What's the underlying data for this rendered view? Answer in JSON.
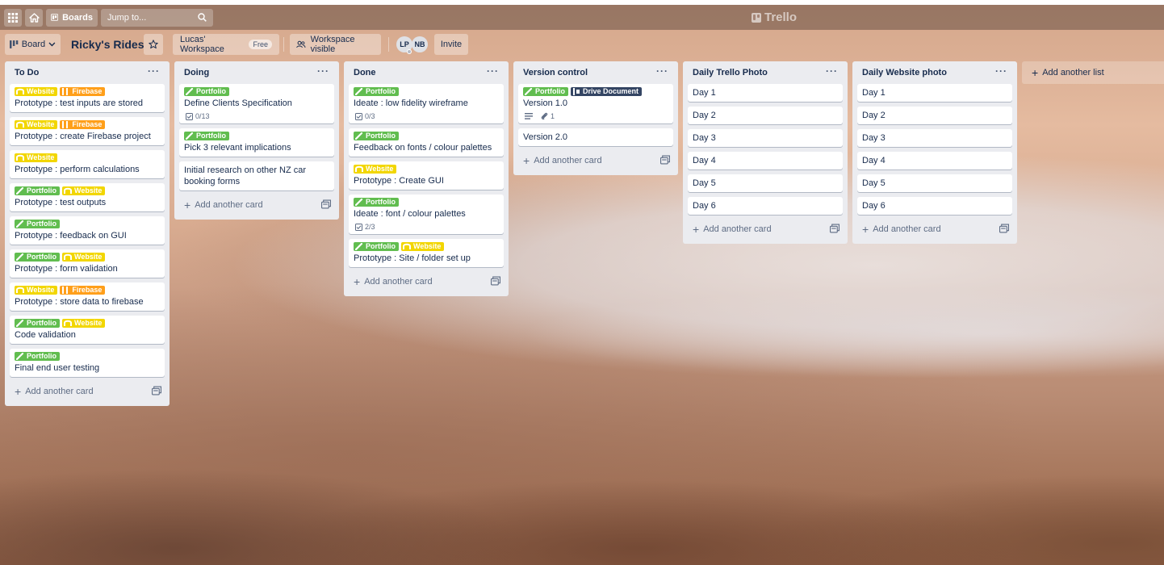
{
  "app": {
    "logo": "Trello"
  },
  "header": {
    "apps_icon": "grid-icon",
    "home_icon": "house-icon",
    "boards_label": "Boards",
    "search_placeholder": "Jump to..."
  },
  "board": {
    "view_label": "Board",
    "title": "Ricky's Rides",
    "workspace_label": "Lucas' Workspace",
    "workspace_badge": "Free",
    "visibility_label": "Workspace visible",
    "members": [
      "LP",
      "NB"
    ],
    "invite_label": "Invite"
  },
  "colors": {
    "green": "#61bd4f",
    "yellow": "#f2d600",
    "orange": "#ff9f1a",
    "navy": "#344563",
    "list_bg": "#ebecf0"
  },
  "add_card_label": "Add another card",
  "add_list_label": "Add another list",
  "lists": [
    {
      "title": "To Do",
      "cards": [
        {
          "labels": [
            {
              "text": "Website",
              "color": "yellow"
            },
            {
              "text": "Firebase",
              "color": "orange"
            }
          ],
          "title": "Prototype : test inputs are stored"
        },
        {
          "labels": [
            {
              "text": "Website",
              "color": "yellow"
            },
            {
              "text": "Firebase",
              "color": "orange"
            }
          ],
          "title": "Prototype : create Firebase project"
        },
        {
          "labels": [
            {
              "text": "Website",
              "color": "yellow"
            }
          ],
          "title": "Prototype : perform calculations"
        },
        {
          "labels": [
            {
              "text": "Portfolio",
              "color": "green"
            },
            {
              "text": "Website",
              "color": "yellow"
            }
          ],
          "title": "Prototype : test outputs"
        },
        {
          "labels": [
            {
              "text": "Portfolio",
              "color": "green"
            }
          ],
          "title": "Prototype : feedback on GUI"
        },
        {
          "labels": [
            {
              "text": "Portfolio",
              "color": "green"
            },
            {
              "text": "Website",
              "color": "yellow"
            }
          ],
          "title": "Prototype : form validation"
        },
        {
          "labels": [
            {
              "text": "Website",
              "color": "yellow"
            },
            {
              "text": "Firebase",
              "color": "orange"
            }
          ],
          "title": "Prototype : store data to firebase"
        },
        {
          "labels": [
            {
              "text": "Portfolio",
              "color": "green"
            },
            {
              "text": "Website",
              "color": "yellow"
            }
          ],
          "title": "Code validation"
        },
        {
          "labels": [
            {
              "text": "Portfolio",
              "color": "green"
            }
          ],
          "title": "Final end user testing"
        }
      ]
    },
    {
      "title": "Doing",
      "cards": [
        {
          "labels": [
            {
              "text": "Portfolio",
              "color": "green"
            }
          ],
          "title": "Define Clients Specification",
          "checklist": "0/13"
        },
        {
          "labels": [
            {
              "text": "Portfolio",
              "color": "green"
            }
          ],
          "title": "Pick 3 relevant implications"
        },
        {
          "labels": [],
          "title": "Initial research on other NZ car booking forms"
        }
      ]
    },
    {
      "title": "Done",
      "cards": [
        {
          "labels": [
            {
              "text": "Portfolio",
              "color": "green"
            }
          ],
          "title": "Ideate : low fidelity wireframe",
          "checklist": "0/3"
        },
        {
          "labels": [
            {
              "text": "Portfolio",
              "color": "green"
            }
          ],
          "title": "Feedback on fonts / colour palettes"
        },
        {
          "labels": [
            {
              "text": "Website",
              "color": "yellow"
            }
          ],
          "title": "Prototype : Create GUI"
        },
        {
          "labels": [
            {
              "text": "Portfolio",
              "color": "green"
            }
          ],
          "title": "Ideate : font / colour palettes",
          "checklist": "2/3"
        },
        {
          "labels": [
            {
              "text": "Portfolio",
              "color": "green"
            },
            {
              "text": "Website",
              "color": "yellow"
            }
          ],
          "title": "Prototype : Site / folder set up"
        }
      ]
    },
    {
      "title": "Version control",
      "cards": [
        {
          "labels": [
            {
              "text": "Portfolio",
              "color": "green"
            },
            {
              "text": "Drive Document",
              "color": "navy"
            }
          ],
          "title": "Version 1.0",
          "has_description": true,
          "attachments": "1"
        },
        {
          "labels": [],
          "title": "Version 2.0"
        }
      ]
    },
    {
      "title": "Daily Trello Photo",
      "cards": [
        {
          "labels": [],
          "title": "Day 1"
        },
        {
          "labels": [],
          "title": "Day 2"
        },
        {
          "labels": [],
          "title": "Day 3"
        },
        {
          "labels": [],
          "title": "Day 4"
        },
        {
          "labels": [],
          "title": "Day 5"
        },
        {
          "labels": [],
          "title": "Day 6"
        }
      ]
    },
    {
      "title": "Daily Website photo",
      "cards": [
        {
          "labels": [],
          "title": "Day 1"
        },
        {
          "labels": [],
          "title": "Day 2"
        },
        {
          "labels": [],
          "title": "Day 3"
        },
        {
          "labels": [],
          "title": "Day 4"
        },
        {
          "labels": [],
          "title": "Day 5"
        },
        {
          "labels": [],
          "title": "Day 6"
        }
      ]
    }
  ]
}
